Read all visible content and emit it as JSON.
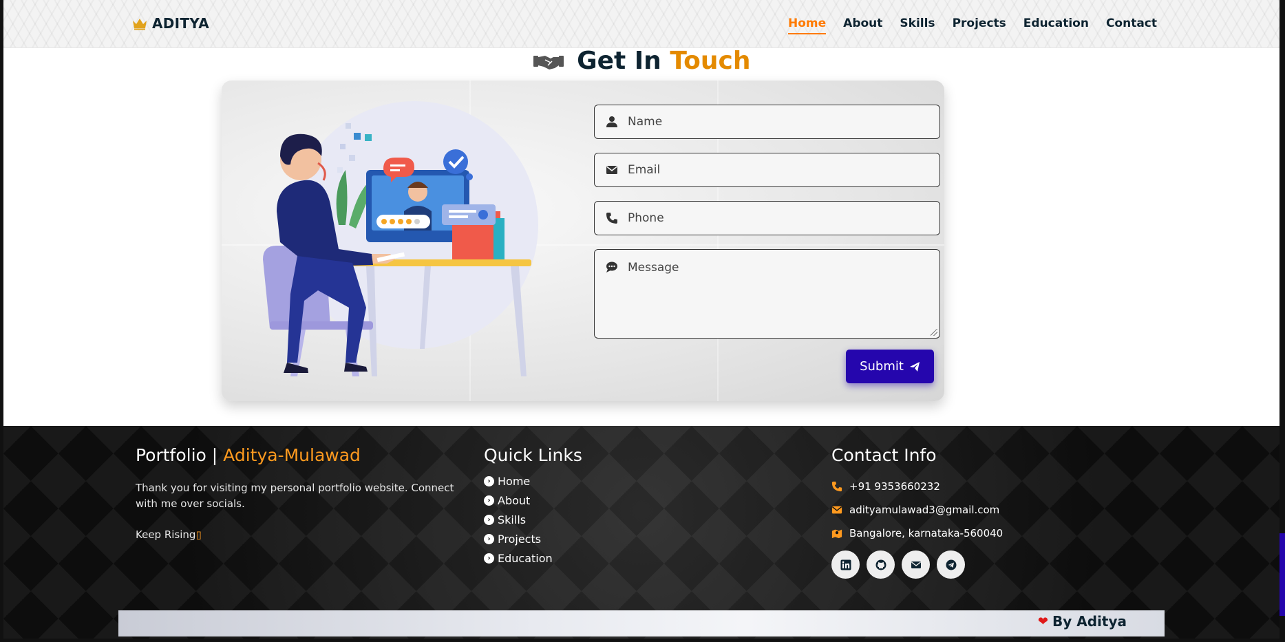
{
  "nav": {
    "brand": "ADITYA",
    "links": [
      {
        "label": "Home",
        "active": true
      },
      {
        "label": "About"
      },
      {
        "label": "Skills"
      },
      {
        "label": "Projects"
      },
      {
        "label": "Education"
      },
      {
        "label": "Contact"
      }
    ]
  },
  "heading": {
    "part1": "Get In",
    "part2": "Touch"
  },
  "form": {
    "name_placeholder": "Name",
    "email_placeholder": "Email",
    "phone_placeholder": "Phone",
    "message_placeholder": "Message",
    "submit_label": "Submit"
  },
  "footer": {
    "about": {
      "title_prefix": "Portfolio |",
      "title_accent": "Aditya-Mulawad",
      "text": "Thank you for visiting my personal portfolio website. Connect with me over socials.",
      "tagline": "Keep Rising"
    },
    "quick_links": {
      "title": "Quick Links",
      "items": [
        "Home",
        "About",
        "Skills",
        "Projects",
        "Education"
      ]
    },
    "contact": {
      "title": "Contact Info",
      "phone": "+91 9353660232",
      "email": "adityamulawad3@gmail.com",
      "address": "Bangalore, karnataka-560040"
    },
    "socials": [
      "linkedin-icon",
      "github-icon",
      "mail-icon",
      "telegram-icon"
    ],
    "credit": "By Aditya"
  },
  "colors": {
    "accent": "#ff7a00",
    "primary": "#2506ad",
    "dark": "#0e2431"
  }
}
